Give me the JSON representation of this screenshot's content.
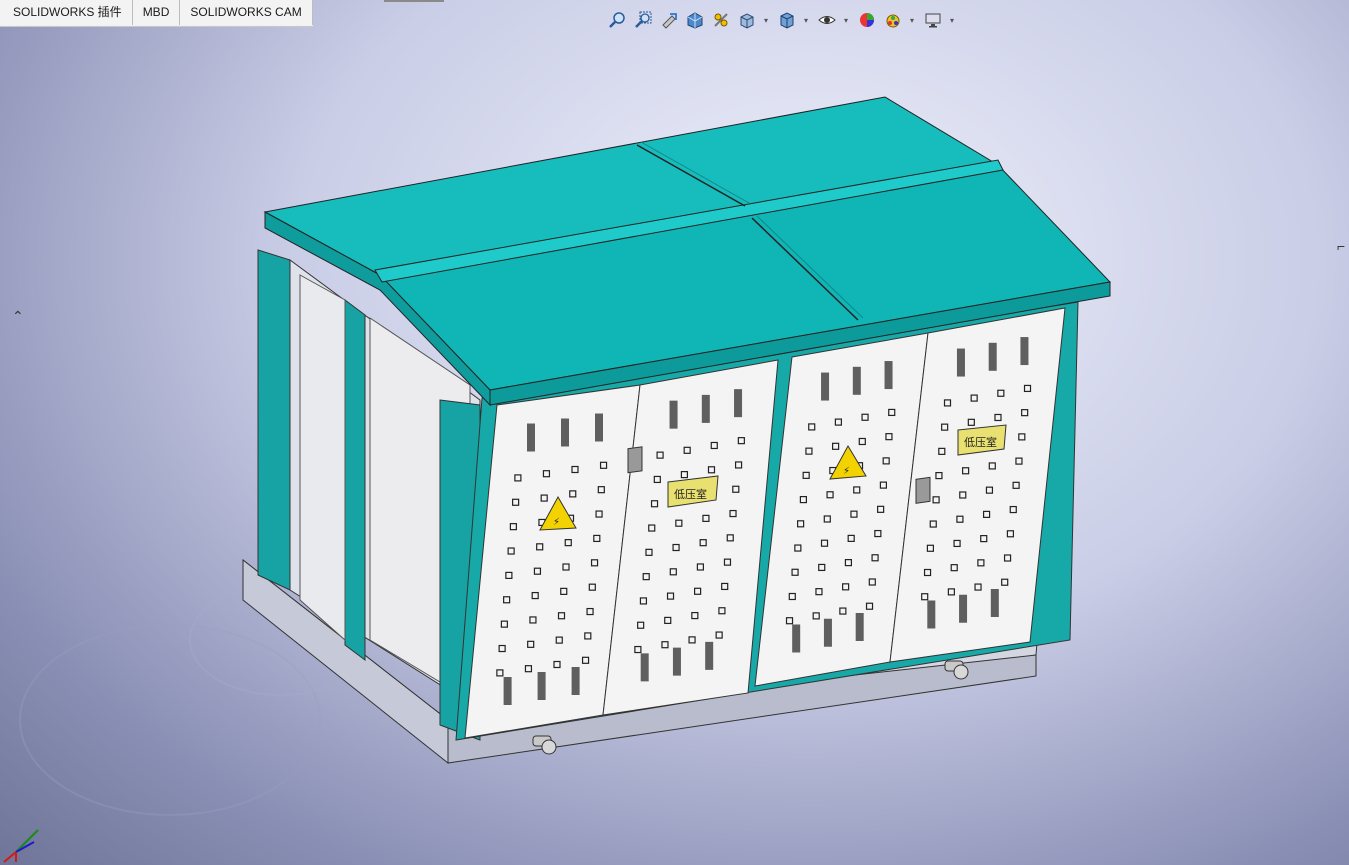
{
  "tabs": [
    {
      "label": "SOLIDWORKS 插件"
    },
    {
      "label": "MBD"
    },
    {
      "label": "SOLIDWORKS CAM"
    }
  ],
  "toolbar": {
    "items": [
      {
        "icon": "zoom-to-fit-icon"
      },
      {
        "icon": "zoom-to-area-icon"
      },
      {
        "icon": "previous-view-icon"
      },
      {
        "icon": "section-view-icon"
      },
      {
        "icon": "dynamic-annotation-icon"
      },
      {
        "icon": "view-orientation-icon",
        "dropdown": true
      },
      {
        "icon": "display-style-icon",
        "dropdown": true
      },
      {
        "icon": "hide-show-items-icon",
        "dropdown": true
      },
      {
        "icon": "edit-appearance-icon"
      },
      {
        "icon": "apply-scene-icon",
        "dropdown": true
      },
      {
        "icon": "view-settings-icon",
        "dropdown": true
      }
    ]
  },
  "model": {
    "signs": {
      "left_label": "低压室",
      "right_label": "低压室"
    },
    "colors": {
      "roof": "#15bdbd",
      "roof_dark": "#0a9a9a",
      "frame": "#1aa8a8",
      "door": "#f4f4f4",
      "base": "#b8bccc",
      "warning": "#f2d200",
      "sign": "#e8e070"
    }
  }
}
